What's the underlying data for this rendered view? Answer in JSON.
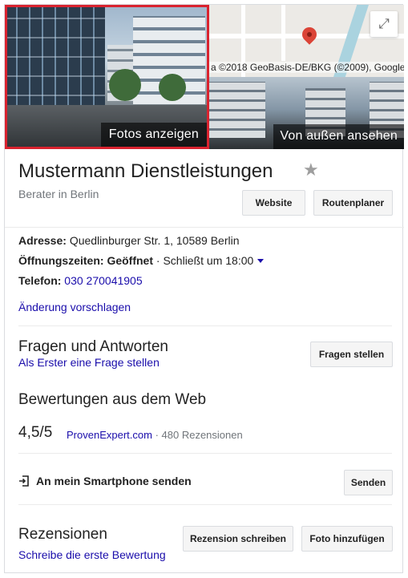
{
  "photos": {
    "left_label": "Fotos anzeigen",
    "right_label": "Von außen ansehen",
    "map_attribution": "a ©2018 GeoBasis-DE/BKG (©2009), Google",
    "expand_icon": "expand-icon"
  },
  "business": {
    "name": "Mustermann Dienstleistungen",
    "category": "Berater in Berlin",
    "buttons": {
      "website": "Website",
      "route": "Routenplaner"
    }
  },
  "details": {
    "address_label": "Adresse:",
    "address_value": "Quedlinburger Str. 1, 10589 Berlin",
    "hours_label": "Öffnungszeiten:",
    "hours_status": "Geöffnet",
    "hours_separator": "·",
    "hours_close": "Schließt um 18:00",
    "phone_label": "Telefon:",
    "phone_value": "030 270041905",
    "suggest_edit": "Änderung vorschlagen"
  },
  "qa": {
    "title": "Fragen und Antworten",
    "subtitle": "Als Erster eine Frage stellen",
    "button": "Fragen stellen"
  },
  "web_reviews": {
    "title": "Bewertungen aus dem Web",
    "rating": "4,5/5",
    "source": "ProvenExpert.com",
    "separator": "·",
    "count": "480 Rezensionen"
  },
  "send": {
    "label": "An mein Smartphone senden",
    "button": "Senden"
  },
  "reviews": {
    "title": "Rezensionen",
    "subtitle": "Schreibe die erste Bewertung",
    "write_button": "Rezension schreiben",
    "photo_button": "Foto hinzufügen"
  },
  "colors": {
    "link": "#1a0dab",
    "highlight": "#d9232f",
    "pin": "#db4437"
  }
}
